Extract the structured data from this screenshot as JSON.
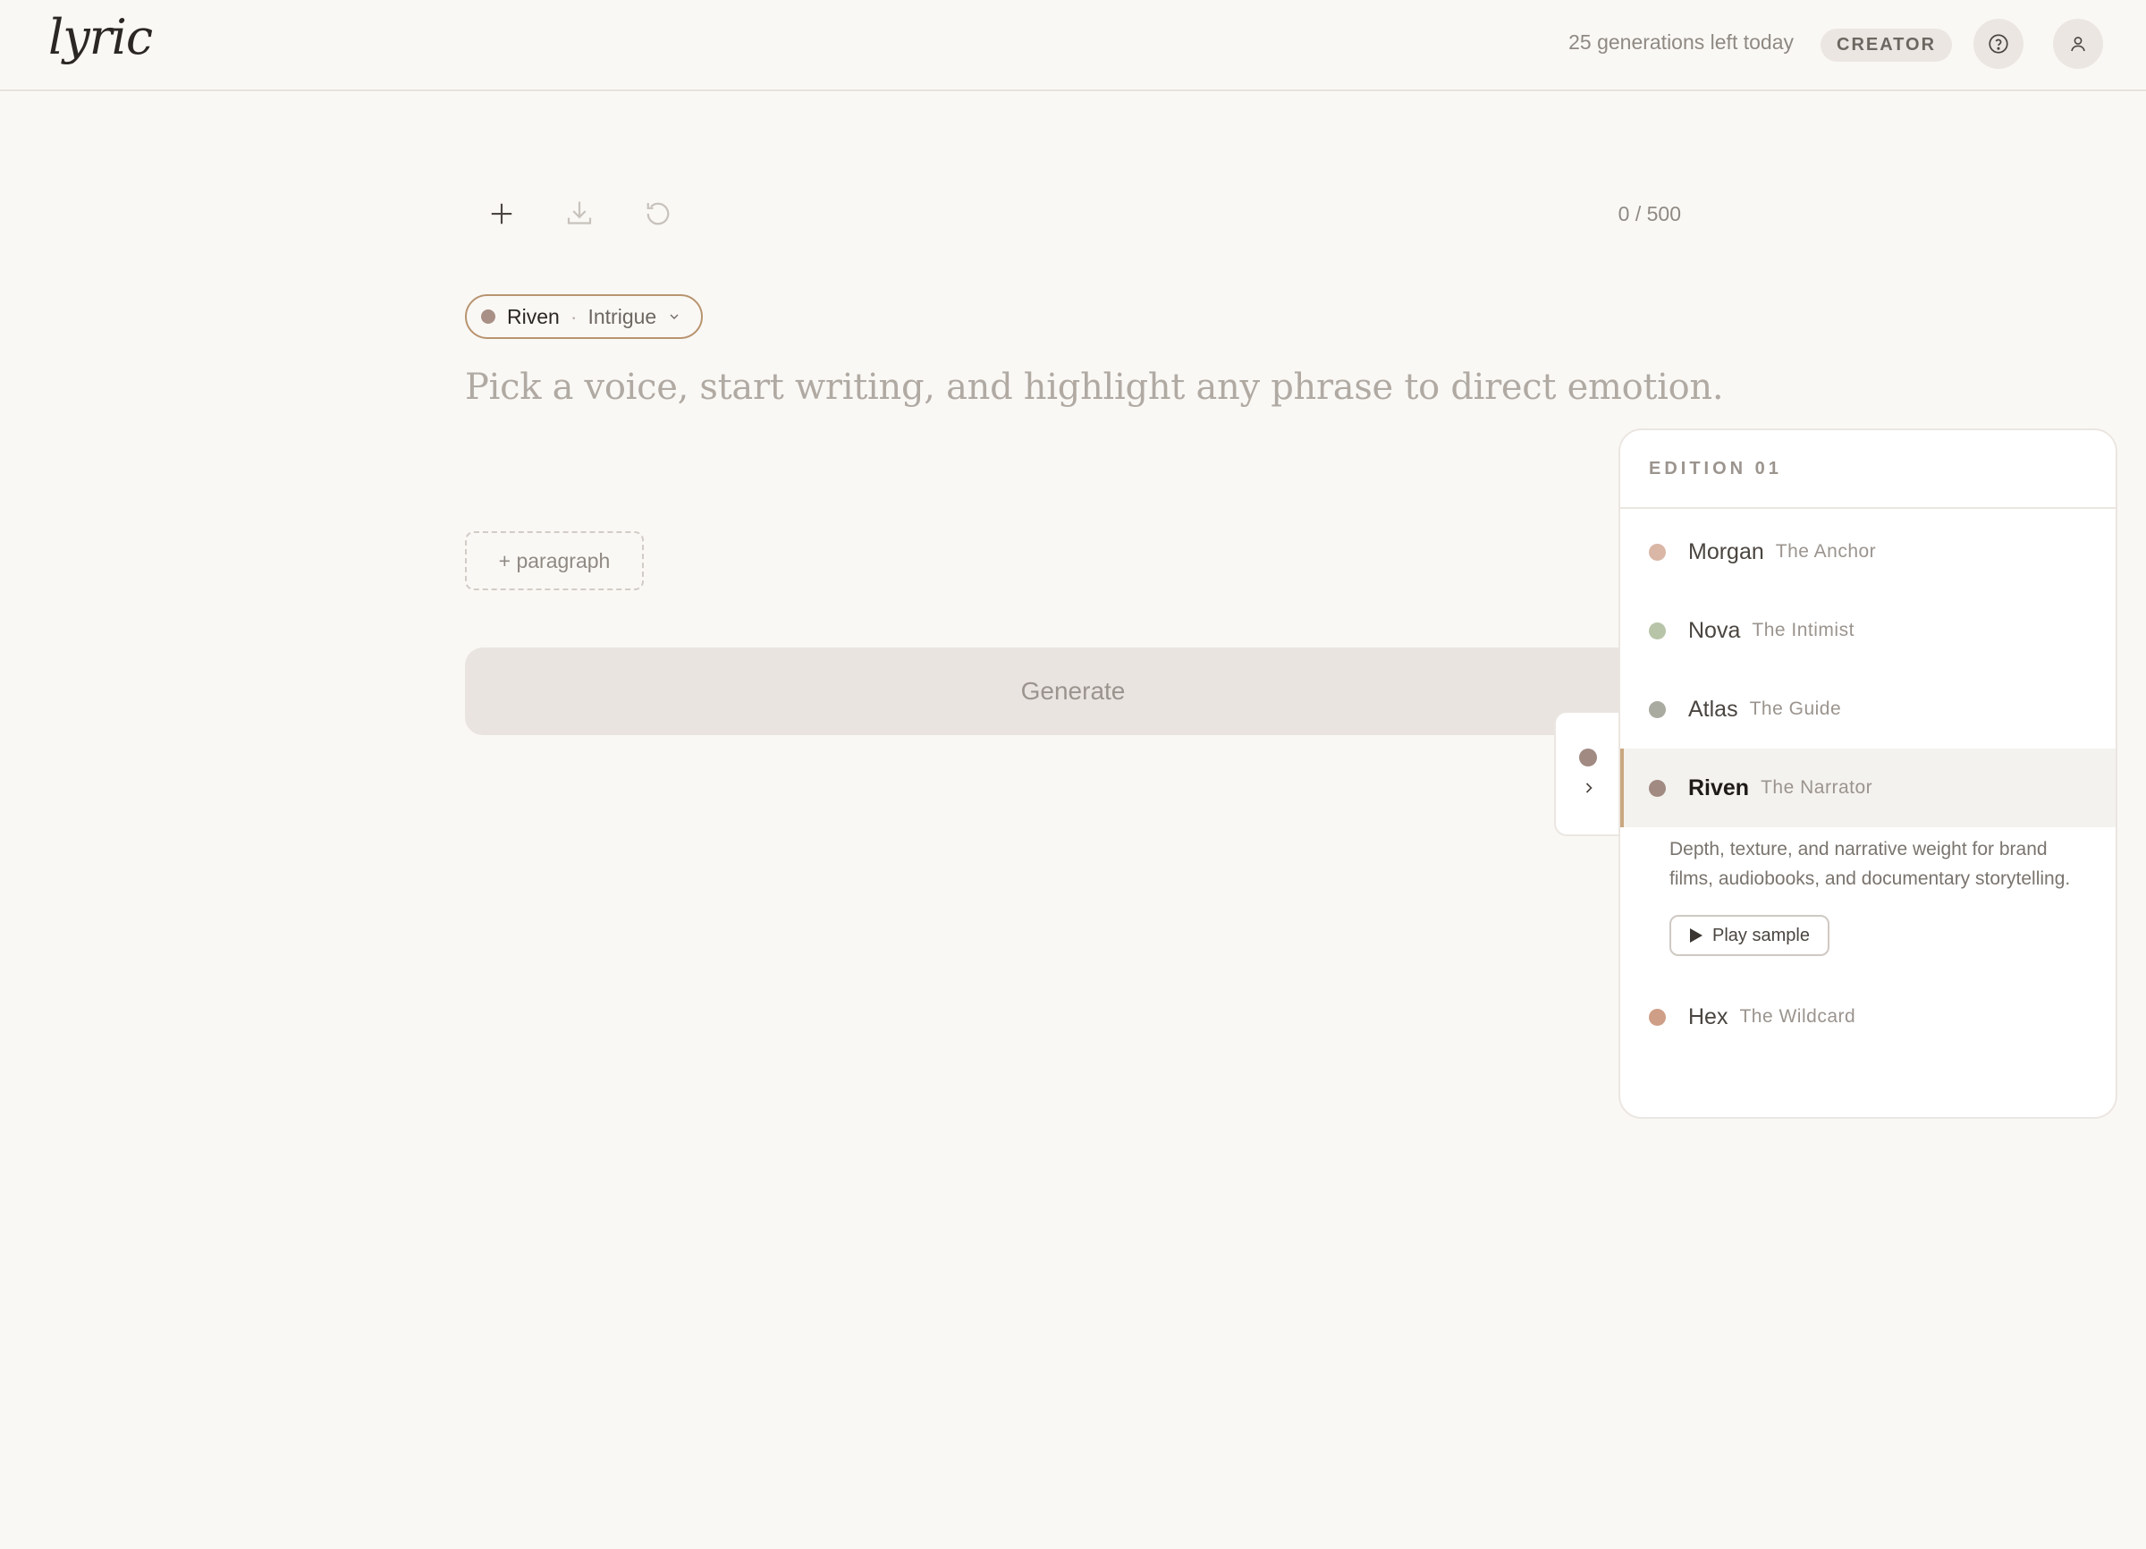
{
  "header": {
    "logo": "lyric",
    "generations_left": "25 generations left today",
    "plan_badge": "CREATOR",
    "help_icon": "help-circle-icon",
    "account_icon": "user-icon"
  },
  "toolbar": {
    "add_icon": "plus-icon",
    "download_icon": "download-icon",
    "reset_icon": "refresh-icon",
    "char_counter": "0 / 500"
  },
  "editor": {
    "voice_chip": {
      "voice": "Riven",
      "separator": "·",
      "mood": "Intrigue",
      "dot_color": "#a89086"
    },
    "placeholder": "Pick a voice, start writing, and highlight any phrase to direct emotion.",
    "add_paragraph_label": "+ paragraph",
    "generate_label": "Generate"
  },
  "voice_panel": {
    "title": "EDITION 01",
    "voices": [
      {
        "name": "Morgan",
        "role": "The Anchor",
        "color": "#d9b6a6"
      },
      {
        "name": "Nova",
        "role": "The Intimist",
        "color": "#b8c4a8"
      },
      {
        "name": "Atlas",
        "role": "The Guide",
        "color": "#a9aaa0"
      },
      {
        "name": "Riven",
        "role": "The Narrator",
        "color": "#a08a82",
        "selected": true,
        "description": "Depth, texture, and narrative weight for brand films, audiobooks, and documentary storytelling.",
        "play_label": "Play sample"
      },
      {
        "name": "Hex",
        "role": "The Wildcard",
        "color": "#cf9e86"
      }
    ]
  },
  "colors": {
    "accent": "#b8946f",
    "background": "#faf8f5",
    "selected_bar": "#c9a77f"
  }
}
